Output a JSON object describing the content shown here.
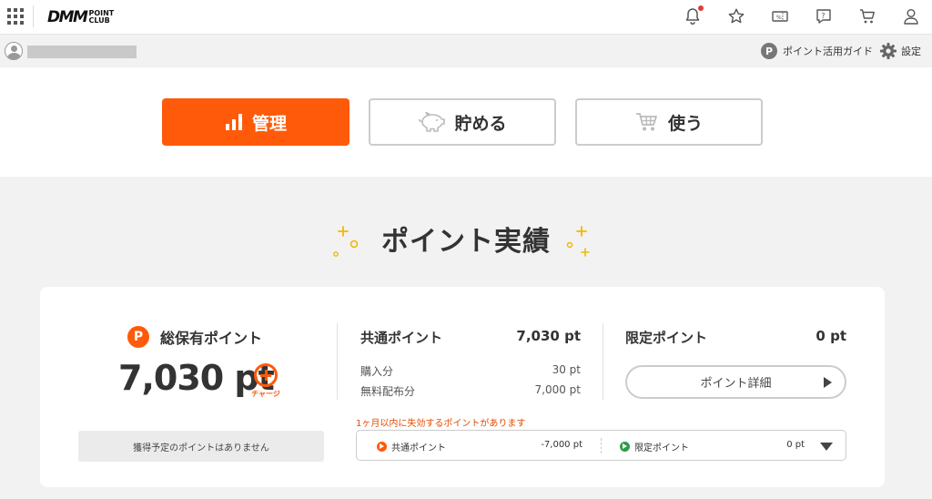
{
  "header": {
    "logo_main": "DMM",
    "logo_sub_top": "POINT",
    "logo_sub_bottom": "CLUB"
  },
  "icons": {
    "apps": "grid-icon",
    "notifications": "bell-icon",
    "favorites": "star-icon",
    "coupons": "coupon-icon",
    "help": "help-icon",
    "cart": "cart-icon",
    "account": "user-icon"
  },
  "userbar": {
    "guide_label": "ポイント活用ガイド",
    "guide_badge": "P",
    "settings_label": "設定"
  },
  "tabs": [
    {
      "label": "管理",
      "active": true
    },
    {
      "label": "貯める",
      "active": false
    },
    {
      "label": "使う",
      "active": false
    }
  ],
  "section": {
    "title": "ポイント実績"
  },
  "summary": {
    "total_label": "総保有ポイント",
    "total_badge": "P",
    "total_value": "7,030 pt",
    "charge_label": "チャージ",
    "pending_message": "獲得予定のポイントはありません"
  },
  "common": {
    "label": "共通ポイント",
    "value": "7,030 pt",
    "rows": [
      {
        "label": "購入分",
        "value": "30 pt"
      },
      {
        "label": "無料配布分",
        "value": "7,000 pt"
      }
    ]
  },
  "limited": {
    "label": "限定ポイント",
    "value": "0 pt",
    "detail_button": "ポイント詳細"
  },
  "expiring": {
    "warning": "1ヶ月以内に失効するポイントがあります",
    "common_label": "共通ポイント",
    "common_value": "-7,000 pt",
    "limited_label": "限定ポイント",
    "limited_value": "0 pt"
  },
  "colors": {
    "accent": "#ff5a0a",
    "limited_green": "#2e9d45",
    "warning_text": "#e04b00"
  }
}
